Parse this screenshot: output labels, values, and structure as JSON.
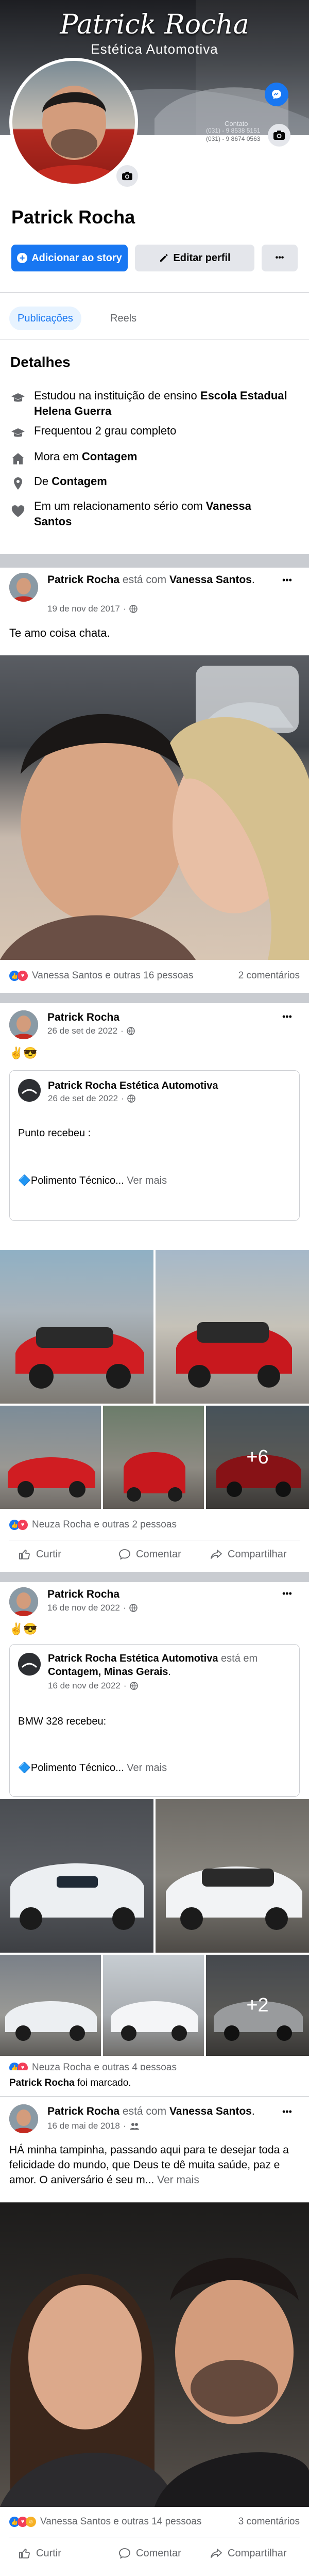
{
  "profile": {
    "cover_title": "Patrick Rocha",
    "cover_subtitle": "Estética Automotiva",
    "cover_contact_label": "Contato",
    "cover_phone_1": "(031) - 9 8538 5151",
    "cover_phone_2": "(031) - 9 8674 0563",
    "name": "Patrick Rocha",
    "add_story_label": "Adicionar ao story",
    "edit_profile_label": "Editar perfil",
    "more_label": "•••"
  },
  "tabs": [
    {
      "label": "Publicações",
      "active": true
    },
    {
      "label": "Reels",
      "active": false
    }
  ],
  "details": {
    "title": "Detalhes",
    "study_prefix": "Estudou na instituição de ensino ",
    "study_school": "Escola Estadual Helena Guerra",
    "high_school": "Frequentou 2 grau completo",
    "lives_prefix": "Mora em ",
    "lives_city": "Contagem",
    "from_prefix": "De ",
    "from_city": "Contagem",
    "relationship_prefix": "Em um relacionamento sério com ",
    "relationship_partner": "Vanessa Santos"
  },
  "posts": [
    {
      "author": "Patrick Rocha",
      "connector": " está com ",
      "tagged": "Vanessa Santos",
      "tagged_end": ".",
      "date": "19 de nov de 2017",
      "text": "Te amo coisa chata.",
      "reactions": "Vanessa Santos e outras 16 pessoas",
      "comments": "2 comentários"
    },
    {
      "author": "Patrick Rocha",
      "date": "26 de set de 2022",
      "text": "✌😎",
      "shared_author": "Patrick Rocha Estética Automotiva",
      "shared_date": "26 de set de 2022",
      "shared_text": "Punto recebeu :",
      "shared_more_prefix": "🔷Polimento Técnico...",
      "see_more": "Ver mais",
      "extra_photos": "+6",
      "reactions": "Neuza Rocha e outras 2 pessoas",
      "like_label": "Curtir",
      "comment_label": "Comentar",
      "share_label": "Compartilhar"
    },
    {
      "author": "Patrick Rocha",
      "date": "16 de nov de 2022",
      "text": "✌😎",
      "shared_author": "Patrick Rocha Estética Automotiva",
      "shared_connector": " está em ",
      "shared_place": "Contagem, Minas Gerais",
      "shared_place_end": ".",
      "shared_date": "16 de nov de 2022",
      "shared_text": "BMW 328 recebeu:",
      "shared_more_prefix": "🔷Polimento Técnico...",
      "see_more": "Ver mais",
      "extra_photos": "+2",
      "reactions": "Neuza Rocha e outras 4 pessoas"
    },
    {
      "tag_header_name": "Patrick Rocha",
      "tag_header_rest": " foi marcado.",
      "author": "Patrick Rocha",
      "connector": " está com ",
      "tagged": "Vanessa Santos",
      "tagged_end": ".",
      "date": "16 de mai de 2018",
      "text": "HÁ minha tampinha, passando aqui para te desejar toda a felicidade do mundo, que Deus te dê muita saúde, paz e amor. O aniversário é seu m...",
      "see_more": "Ver mais",
      "reactions": "Vanessa Santos e outras 14 pessoas",
      "comments": "3 comentários",
      "like_label": "Curtir",
      "comment_label": "Comentar",
      "share_label": "Compartilhar"
    }
  ],
  "colors": {
    "accent": "#1877f2",
    "like": "#1877f2",
    "love": "#f33e58",
    "haha": "#f7b125"
  }
}
